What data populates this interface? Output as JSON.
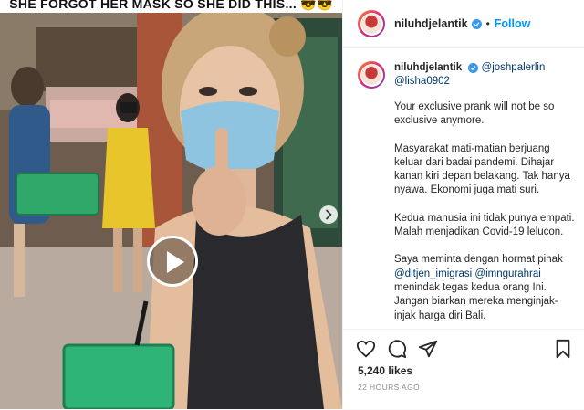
{
  "media": {
    "banner_text": "SHE FORGOT HER MASK SO SHE DID THIS... 😎😎"
  },
  "header": {
    "username": "niluhdjelantik",
    "follow_label": "Follow",
    "separator": "•"
  },
  "comment": {
    "username": "niluhdjelantik",
    "mention_1": "@joshpalerlin",
    "mention_2": "@lisha0902"
  },
  "caption": {
    "p1": "Your exclusive prank will not be so exclusive anymore.",
    "p2": "Masyarakat mati-matian berjuang keluar dari badai pandemi. Dihajar kanan kiri depan belakang. Tak hanya nyawa. Ekonomi juga mati suri.",
    "p3": "Kedua manusia ini tidak punya empati. Malah menjadikan Covid-19 lelucon.",
    "p4_text": "Saya meminta dengan hormat pihak",
    "p4_mention_1": "@ditjen_imigrasi",
    "p4_mention_2": "@imngurahrai",
    "p4_rest": "menindak tegas kedua orang Ini. Jangan biarkan mereka menginjak-injak harga diri Bali."
  },
  "footer": {
    "likes": "5,240 likes",
    "timestamp": "22 HOURS AGO"
  },
  "icons": [
    "play-icon",
    "chevron-right-icon",
    "verified-icon",
    "heart-icon",
    "comment-icon",
    "share-icon",
    "bookmark-icon"
  ],
  "colors": {
    "link": "#0095f6",
    "mention": "#00376b",
    "verified": "#3897f0"
  }
}
